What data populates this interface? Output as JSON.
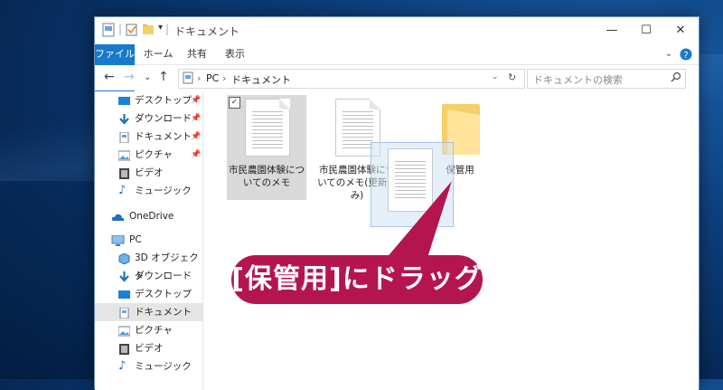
{
  "window": {
    "title": "ドキュメント",
    "controls": {
      "minimize": "—",
      "maximize": "☐",
      "close": "✕"
    }
  },
  "ribbon": {
    "tabs": [
      {
        "label": "ファイル"
      },
      {
        "label": "ホーム"
      },
      {
        "label": "共有"
      },
      {
        "label": "表示"
      }
    ]
  },
  "address": {
    "path": [
      "PC",
      "ドキュメント"
    ],
    "search_placeholder": "ドキュメントの検索"
  },
  "sidebar": {
    "quick_access": [
      {
        "label": "デスクトップ",
        "icon": "desktop-icon"
      },
      {
        "label": "ダウンロード",
        "icon": "download-icon"
      },
      {
        "label": "ドキュメント",
        "icon": "document-icon"
      },
      {
        "label": "ピクチャ",
        "icon": "picture-icon"
      },
      {
        "label": "ビデオ",
        "icon": "video-icon"
      },
      {
        "label": "ミュージック",
        "icon": "music-icon"
      }
    ],
    "onedrive": {
      "label": "OneDrive",
      "icon": "cloud-icon"
    },
    "pc": {
      "label": "PC",
      "icon": "computer-icon"
    },
    "pc_items": [
      {
        "label": "3D オブジェクト",
        "icon": "cube-icon"
      },
      {
        "label": "ダウンロード",
        "icon": "download-icon"
      },
      {
        "label": "デスクトップ",
        "icon": "desktop-icon"
      },
      {
        "label": "ドキュメント",
        "icon": "document-icon"
      },
      {
        "label": "ピクチャ",
        "icon": "picture-icon"
      },
      {
        "label": "ビデオ",
        "icon": "video-icon"
      },
      {
        "label": "ミュージック",
        "icon": "music-icon"
      }
    ]
  },
  "files": [
    {
      "name_line1": "市民農園体験につ",
      "name_line2": "いてのメモ",
      "name_line3": "",
      "selected": true
    },
    {
      "name_line1": "市民農園体験につ",
      "name_line2": "いてのメモ(更新済",
      "name_line3": "み)",
      "selected": false
    },
    {
      "name_line1": "保管用",
      "name_line2": "",
      "name_line3": "",
      "type": "folder"
    }
  ],
  "callout": {
    "text": "[保管用]にドラッグ",
    "color": "#b5154f"
  },
  "colors": {
    "accent": "#1979ca",
    "folder": "#f5cf67"
  }
}
